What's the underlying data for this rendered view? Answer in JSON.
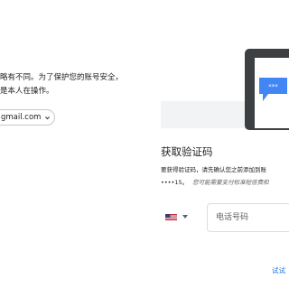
{
  "left": {
    "line1": "略有不同。为了保护您的账号安全，",
    "line2": "是本人在操作。",
    "account_email": "gmail.com"
  },
  "verify": {
    "title": "获取验证码",
    "desc_line1": "要获得验证码，请先确认您之前添加到账",
    "desc_line2_prefix": "••••15。",
    "desc_line2_note": "您可能需要支付标准短信费和",
    "country_flag": "US",
    "phone_placeholder": "电话号码",
    "try_other_link": "试试"
  },
  "colors": {
    "link": "#1a73e8",
    "phone_body": "#3c4043",
    "bubble": "#4285f4"
  },
  "icons": {
    "account_chevron": "chevron-down-icon",
    "country_dropdown": "dropdown-caret-icon",
    "illustration": "phone-message-illustration"
  }
}
